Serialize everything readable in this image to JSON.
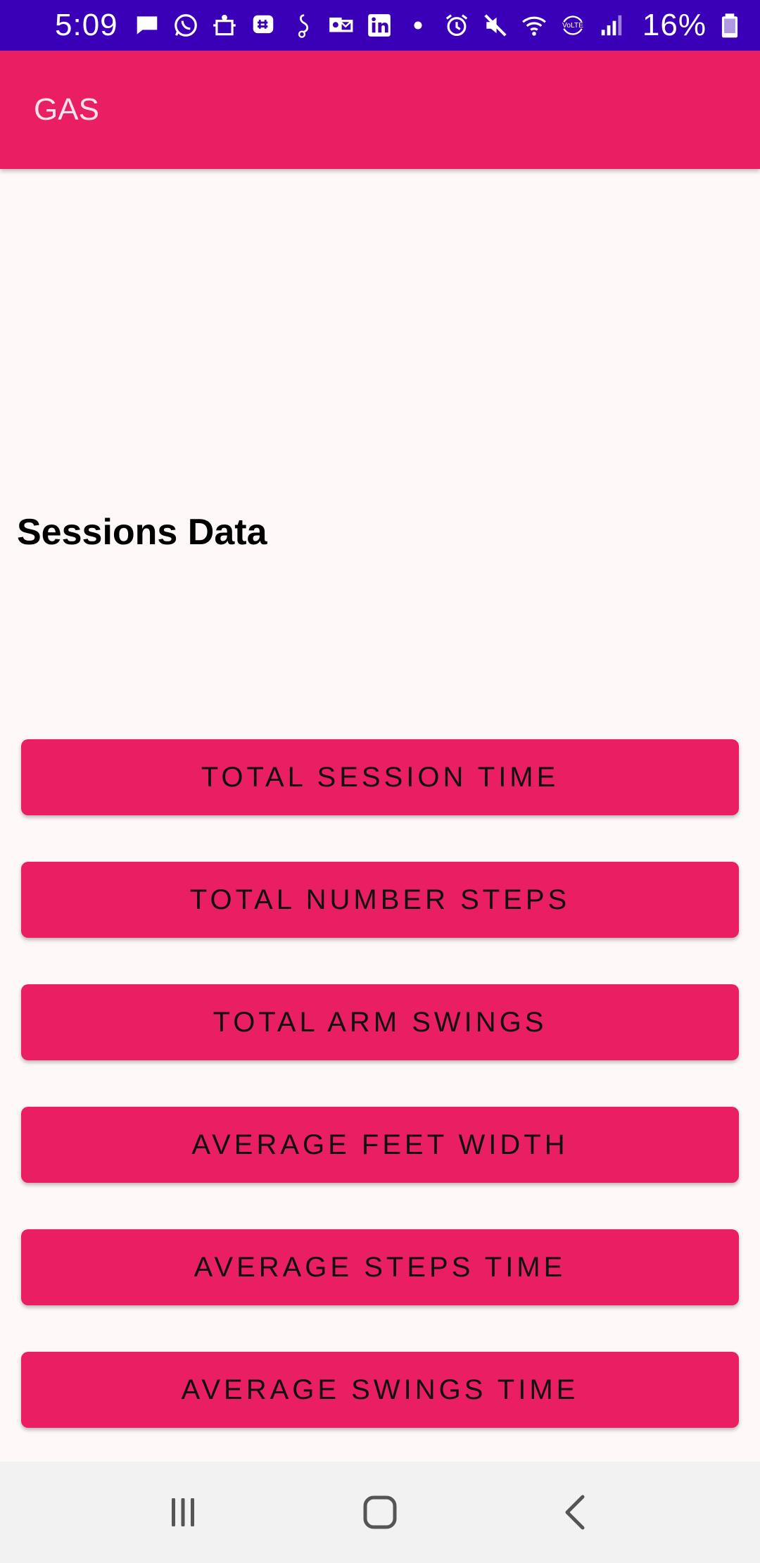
{
  "status_bar": {
    "time": "5:09",
    "battery": "16%",
    "icons": [
      "message-icon",
      "whatsapp-icon",
      "app-icon",
      "slack-icon",
      "sound-icon",
      "outlook-icon",
      "linkedin-icon",
      "dot-icon",
      "alarm-icon",
      "mute-icon",
      "wifi-icon",
      "volte-icon",
      "signal-icon",
      "battery-icon"
    ],
    "background": "#3a00b8"
  },
  "app_bar": {
    "title": "GAS",
    "color": "#e91e63"
  },
  "main": {
    "heading": "Sessions Data",
    "buttons": [
      {
        "label": "TOTAL SESSION TIME"
      },
      {
        "label": "TOTAL NUMBER STEPS"
      },
      {
        "label": "TOTAL ARM SWINGS"
      },
      {
        "label": "AVERAGE FEET WIDTH"
      },
      {
        "label": "AVERAGE STEPS TIME"
      },
      {
        "label": "AVERAGE SWINGS TIME"
      }
    ]
  },
  "nav_bar": {
    "items": [
      "recent-apps-icon",
      "home-icon",
      "back-icon"
    ]
  }
}
